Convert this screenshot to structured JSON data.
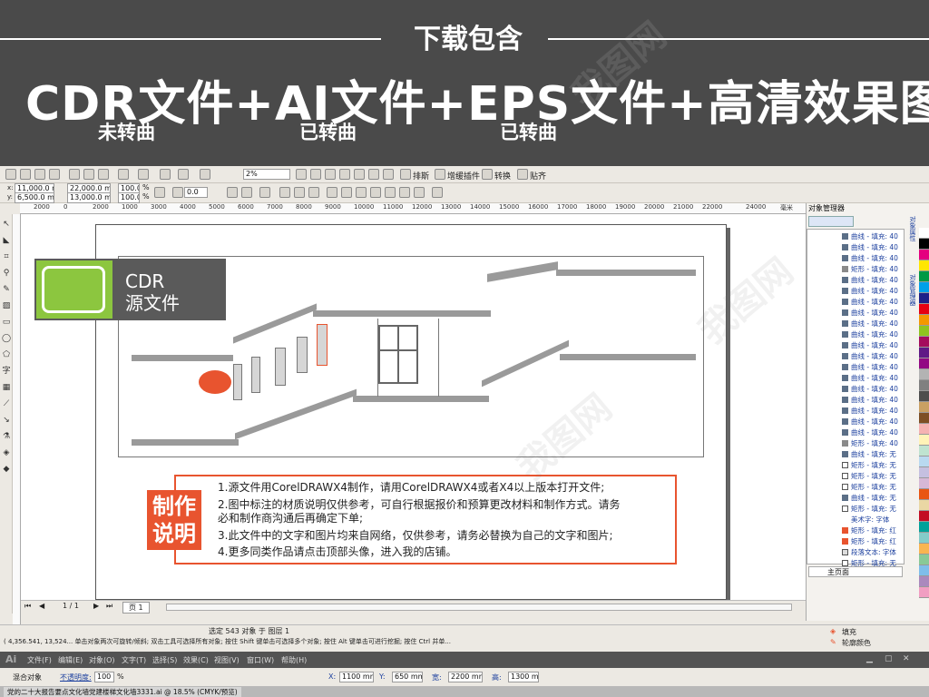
{
  "banner": {
    "download_title": "下载包含",
    "headline": "CDR文件+AI文件+EPS文件+高清效果图",
    "subs": [
      "未转曲",
      "已转曲",
      "已转曲"
    ]
  },
  "menu": {
    "toolbar_labels": [
      "排斯",
      "增缓插件",
      "转换",
      "贴齐"
    ],
    "zoom": "2%"
  },
  "props": {
    "x": "11,000.0 mm",
    "y": "6,500.0 mm",
    "w": "22,000.0 mm",
    "h": "13,000.0 mm",
    "sx": "100.0",
    "sy": "100.0",
    "pct": "%",
    "rot": "0.0"
  },
  "ruler": [
    "2000",
    "0",
    "2000",
    "1000",
    "3000",
    "4000",
    "5000",
    "6000",
    "7000",
    "8000",
    "9000",
    "10000",
    "11000",
    "12000",
    "13000",
    "14000",
    "15000",
    "16000",
    "17000",
    "18000",
    "19000",
    "20000",
    "21000",
    "22000",
    "24000"
  ],
  "ruler_end": "毫米",
  "badge": {
    "line1": "CDR",
    "line2": "源文件"
  },
  "notes": {
    "title_1": "制作",
    "title_2": "说明",
    "l1": "1.源文件用CorelDRAWX4制作，请用CorelDRAWX4或者X4以上版本打开文件;",
    "l2a": "2.图中标注的材质说明仅供参考，可自行根据报价和预算更改材料和制作方式。请务",
    "l2b": "必和制作商沟通后再确定下单;",
    "l3": "3.此文件中的文字和图片均来自网络，仅供参考，请务必替换为自己的文字和图片;",
    "l4": "4.更多同类作品请点击顶部头像，进入我的店铺。"
  },
  "docker": {
    "title": "对象管理器",
    "items": [
      "曲线 - 填充: 40",
      "曲线 - 填充: 40",
      "曲线 - 填充: 40",
      "矩形 - 填充: 40",
      "曲线 - 填充: 40",
      "曲线 - 填充: 40",
      "曲线 - 填充: 40",
      "曲线 - 填充: 40",
      "曲线 - 填充: 40",
      "曲线 - 填充: 40",
      "曲线 - 填充: 40",
      "曲线 - 填充: 40",
      "曲线 - 填充: 40",
      "曲线 - 填充: 40",
      "曲线 - 填充: 40",
      "曲线 - 填充: 40",
      "曲线 - 填充: 40",
      "曲线 - 填充: 40",
      "曲线 - 填充: 40",
      "矩形 - 填充: 40",
      "曲线 - 填充: 无",
      "矩形 - 填充: 无",
      "矩形 - 填充: 无",
      "矩形 - 填充: 无",
      "曲线 - 填充: 无",
      "矩形 - 填充: 无",
      "美术字: 字体",
      "矩形 - 填充: 红",
      "矩形 - 填充: 红",
      "段落文本: 字体",
      "矩形 - 填充: 无"
    ],
    "page": "主页面",
    "side_tabs": [
      "对象属性",
      "对象管理器"
    ]
  },
  "canvas_nav": {
    "page": "1 / 1",
    "tab": "页 1"
  },
  "status": {
    "selection": "选定 543 对象 于 图层 1",
    "coords": "( 4,356.541, 13,524... ",
    "hint": "单击对象两次可旋转/倾斜; 双击工具可选择所有对象; 按住 Shift 键单击可选择多个对象; 按住 Alt 键单击可进行挖掘; 按住 Ctrl 并单...",
    "fill": "填充",
    "outline": "轮廓颜色"
  },
  "ai": {
    "logo": "Ai",
    "menus": [
      "文件(F)",
      "编辑(E)",
      "对象(O)",
      "文字(T)",
      "选择(S)",
      "效果(C)",
      "视图(V)",
      "窗口(W)",
      "帮助(H)"
    ],
    "blend": "混合对象",
    "opacity_label": "不透明度:",
    "opacity": "100",
    "pct": "%",
    "x_label": "X:",
    "x": "1100 mm",
    "y_label": "Y:",
    "y": "650 mm",
    "w_label": "宽:",
    "w": "2200 mm",
    "h_label": "高:",
    "h": "1300 mm",
    "tab": "党的二十大报告要点文化墙党建楼梯文化墙3331.ai @ 18.5% (CMYK/预览)"
  },
  "colors": {
    "banner_bg": "#4a4a4a",
    "accent": "#e8542f",
    "corel_green": "#8cc63f",
    "palette": [
      "#ffffff",
      "#000000",
      "#e4007f",
      "#ffe600",
      "#009944",
      "#00a0e9",
      "#1d2088",
      "#e60012",
      "#f39800",
      "#8fc31f",
      "#a40b5d",
      "#601986",
      "#920783",
      "#b3b3b3",
      "#808080",
      "#4d4d4d",
      "#c9a063",
      "#7d4e24",
      "#f5b2b2",
      "#fff3b8",
      "#bfe3d0",
      "#b9d9f0",
      "#c5c0e0",
      "#d6b8d6",
      "#e95513",
      "#ead7a4",
      "#c30d23",
      "#00a29a",
      "#84ccc9",
      "#f8b551",
      "#89c997",
      "#7fbeea",
      "#aa89bd",
      "#f19ec2"
    ]
  }
}
